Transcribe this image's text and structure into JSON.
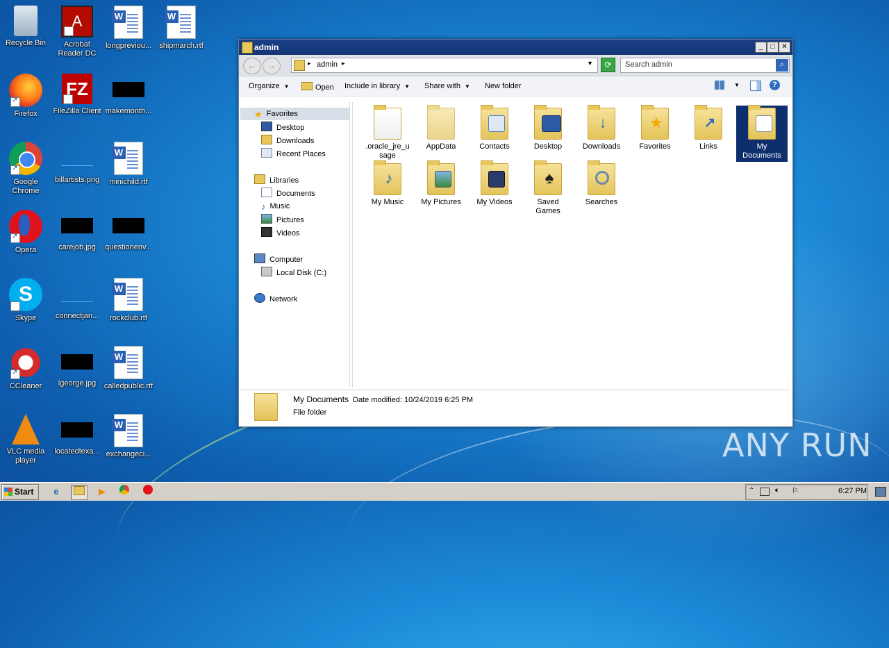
{
  "desktop": {
    "icons": [
      {
        "label": "Recycle Bin"
      },
      {
        "label": "Acrobat Reader DC"
      },
      {
        "label": "longpreviou..."
      },
      {
        "label": "shipmarch.rtf"
      },
      {
        "label": "Firefox"
      },
      {
        "label": "FileZilla Client"
      },
      {
        "label": "makemonth..."
      },
      {
        "label": "Google Chrome"
      },
      {
        "label": "billartists.png"
      },
      {
        "label": "minichild.rtf"
      },
      {
        "label": "Opera"
      },
      {
        "label": "carejob.jpg"
      },
      {
        "label": "questionenv..."
      },
      {
        "label": "Skype"
      },
      {
        "label": "connectjan..."
      },
      {
        "label": "rockclub.rtf"
      },
      {
        "label": "CCleaner"
      },
      {
        "label": "lgeorge.jpg"
      },
      {
        "label": "calledpublic.rtf"
      },
      {
        "label": "VLC media player"
      },
      {
        "label": "locatedtexa..."
      },
      {
        "label": "exchangeci..."
      }
    ]
  },
  "window": {
    "title": "admin",
    "address": "admin",
    "search_placeholder": "Search admin",
    "toolbar": {
      "organize": "Organize",
      "open": "Open",
      "include": "Include in library",
      "share": "Share with",
      "new_folder": "New folder"
    },
    "nav": {
      "favorites": "Favorites",
      "desktop": "Desktop",
      "downloads": "Downloads",
      "recent": "Recent Places",
      "libraries": "Libraries",
      "documents": "Documents",
      "music": "Music",
      "pictures": "Pictures",
      "videos": "Videos",
      "computer": "Computer",
      "localdisk": "Local Disk (C:)",
      "network": "Network"
    },
    "items": [
      {
        "label": ".oracle_jre_usage"
      },
      {
        "label": "AppData"
      },
      {
        "label": "Contacts"
      },
      {
        "label": "Desktop"
      },
      {
        "label": "Downloads"
      },
      {
        "label": "Favorites"
      },
      {
        "label": "Links"
      },
      {
        "label": "My Documents"
      },
      {
        "label": "My Music"
      },
      {
        "label": "My Pictures"
      },
      {
        "label": "My Videos"
      },
      {
        "label": "Saved Games"
      },
      {
        "label": "Searches"
      }
    ],
    "details": {
      "name": "My Documents",
      "modified_label": "Date modified:",
      "modified_value": "10/24/2019 6:25 PM",
      "type": "File folder"
    }
  },
  "taskbar": {
    "start": "Start",
    "clock": "6:27 PM"
  },
  "watermark": "ANY RUN"
}
